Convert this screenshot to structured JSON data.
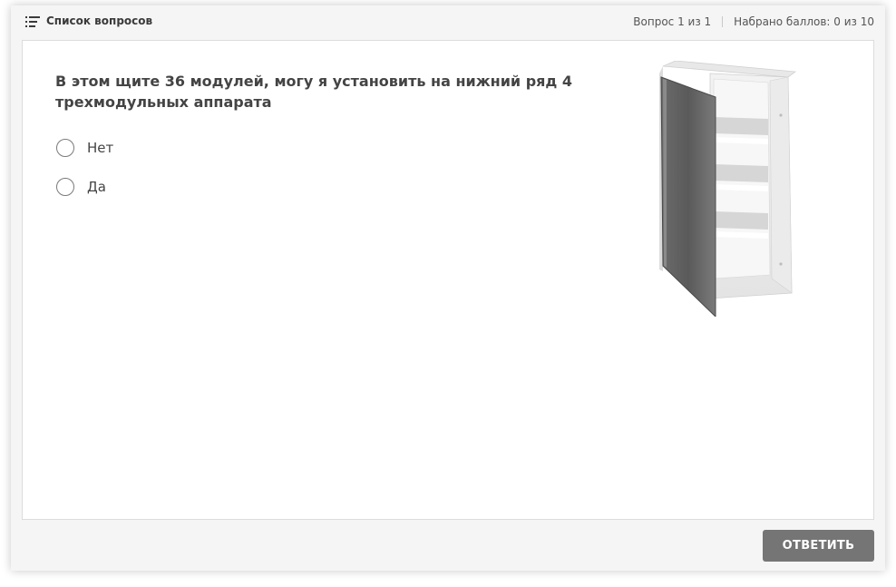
{
  "header": {
    "question_list_label": "Список вопросов",
    "question_counter": "Вопрос 1 из 1",
    "score": "Набрано баллов: 0 из 10"
  },
  "question": {
    "text": "В этом щите 36 модулей, могу я установить на нижний ряд 4 трехмодульных аппарата",
    "options": [
      {
        "label": "Нет",
        "selected": false
      },
      {
        "label": "Да",
        "selected": false
      }
    ],
    "image": "electrical-panel-image"
  },
  "footer": {
    "answer_button_label": "ОТВЕТИТЬ"
  },
  "colors": {
    "background": "#f5f5f5",
    "card": "#ffffff",
    "button": "#757575",
    "text": "#444444"
  }
}
